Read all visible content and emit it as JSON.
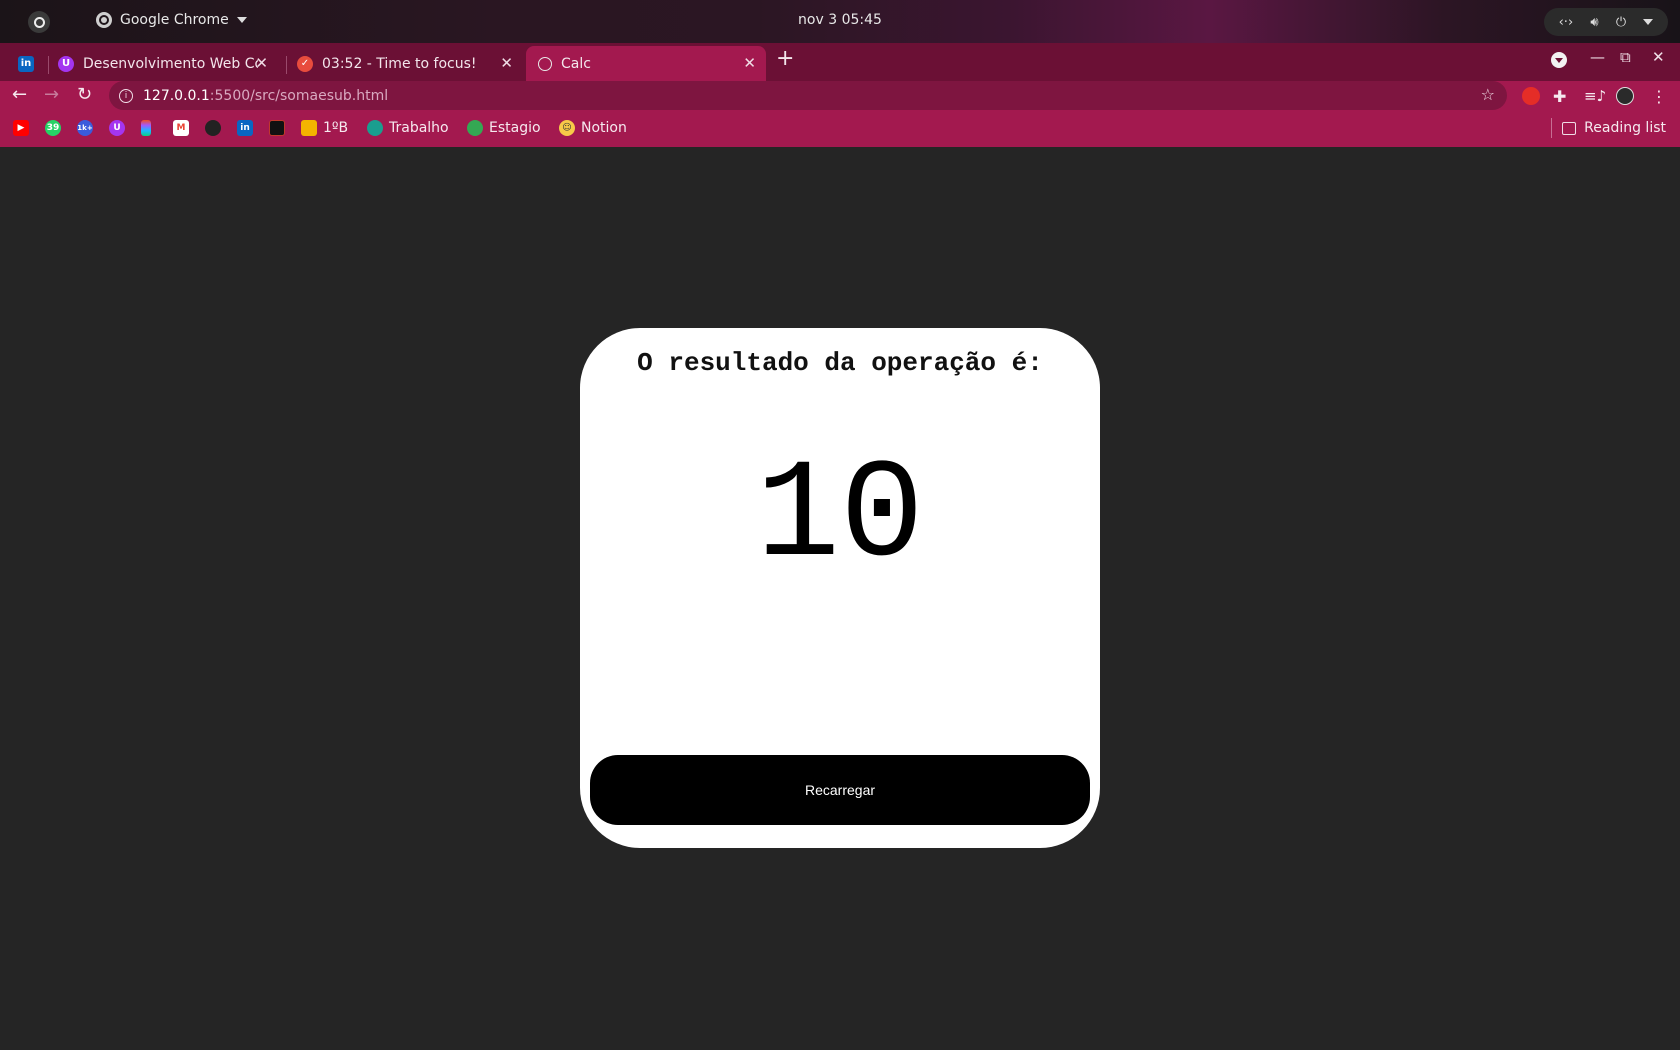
{
  "topbar": {
    "app_name": "Google Chrome",
    "clock": "nov 3  05:45",
    "tray_icons": [
      "network-icon",
      "volume-icon",
      "power-icon",
      "chevron-down-icon"
    ]
  },
  "tabs": [
    {
      "title": "",
      "icon": "linkedin-icon",
      "color": "#0a66c2"
    },
    {
      "title": "Desenvolvimento Web Co",
      "icon": "udemy-icon",
      "color": "#a435f0"
    },
    {
      "title": "03:52 - Time to focus!",
      "icon": "check-circle-icon",
      "color": "#e84c3d"
    },
    {
      "title": "Calc",
      "icon": "globe-icon",
      "color": "#e0e0e0",
      "active": true
    }
  ],
  "toolbar": {
    "url_host": "127.0.0.1",
    "url_path": ":5500/src/somaesub.html"
  },
  "bookmarks": {
    "items": [
      {
        "label": "",
        "icon": "youtube-icon",
        "color": "#ff0000"
      },
      {
        "label": "",
        "icon": "whatsapp-icon",
        "color": "#25d366",
        "badge": "39"
      },
      {
        "label": "",
        "icon": "app-icon",
        "color": "#3b5bdb",
        "badge": "1k+"
      },
      {
        "label": "",
        "icon": "udemy-icon",
        "color": "#a435f0"
      },
      {
        "label": "",
        "icon": "figma-icon",
        "color": "#f24e1e"
      },
      {
        "label": "",
        "icon": "gmail-icon",
        "color": "#ea4335"
      },
      {
        "label": "",
        "icon": "github-icon",
        "color": "#222222"
      },
      {
        "label": "",
        "icon": "linkedin-icon",
        "color": "#0a66c2"
      },
      {
        "label": "",
        "icon": "app-icon",
        "color": "#c0392b"
      },
      {
        "label": "1ºB",
        "icon": "classroom-icon",
        "color": "#f4b400"
      },
      {
        "label": "Trabalho",
        "icon": "drive-icon",
        "color": "#1a9e8f"
      },
      {
        "label": "Estagio",
        "icon": "drive-icon",
        "color": "#34a853"
      },
      {
        "label": "Notion",
        "icon": "emoji-icon",
        "color": "#f7c948"
      }
    ],
    "reading_list": "Reading list"
  },
  "card": {
    "heading": "O resultado da operação é:",
    "result": "10",
    "button_label": "Recarregar"
  },
  "colors": {
    "page_background": "#252525",
    "browser_accent": "#a3194f",
    "tab_strip": "#6b1035"
  }
}
